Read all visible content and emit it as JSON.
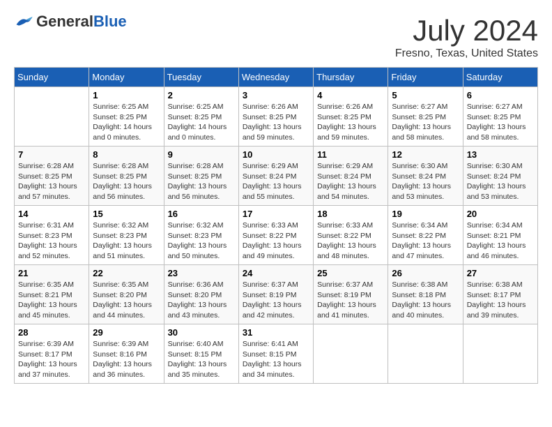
{
  "header": {
    "logo_general": "General",
    "logo_blue": "Blue",
    "title": "July 2024",
    "location": "Fresno, Texas, United States"
  },
  "weekdays": [
    "Sunday",
    "Monday",
    "Tuesday",
    "Wednesday",
    "Thursday",
    "Friday",
    "Saturday"
  ],
  "weeks": [
    [
      {
        "day": "",
        "info": ""
      },
      {
        "day": "1",
        "info": "Sunrise: 6:25 AM\nSunset: 8:25 PM\nDaylight: 14 hours\nand 0 minutes."
      },
      {
        "day": "2",
        "info": "Sunrise: 6:25 AM\nSunset: 8:25 PM\nDaylight: 14 hours\nand 0 minutes."
      },
      {
        "day": "3",
        "info": "Sunrise: 6:26 AM\nSunset: 8:25 PM\nDaylight: 13 hours\nand 59 minutes."
      },
      {
        "day": "4",
        "info": "Sunrise: 6:26 AM\nSunset: 8:25 PM\nDaylight: 13 hours\nand 59 minutes."
      },
      {
        "day": "5",
        "info": "Sunrise: 6:27 AM\nSunset: 8:25 PM\nDaylight: 13 hours\nand 58 minutes."
      },
      {
        "day": "6",
        "info": "Sunrise: 6:27 AM\nSunset: 8:25 PM\nDaylight: 13 hours\nand 58 minutes."
      }
    ],
    [
      {
        "day": "7",
        "info": "Sunrise: 6:28 AM\nSunset: 8:25 PM\nDaylight: 13 hours\nand 57 minutes."
      },
      {
        "day": "8",
        "info": "Sunrise: 6:28 AM\nSunset: 8:25 PM\nDaylight: 13 hours\nand 56 minutes."
      },
      {
        "day": "9",
        "info": "Sunrise: 6:28 AM\nSunset: 8:25 PM\nDaylight: 13 hours\nand 56 minutes."
      },
      {
        "day": "10",
        "info": "Sunrise: 6:29 AM\nSunset: 8:24 PM\nDaylight: 13 hours\nand 55 minutes."
      },
      {
        "day": "11",
        "info": "Sunrise: 6:29 AM\nSunset: 8:24 PM\nDaylight: 13 hours\nand 54 minutes."
      },
      {
        "day": "12",
        "info": "Sunrise: 6:30 AM\nSunset: 8:24 PM\nDaylight: 13 hours\nand 53 minutes."
      },
      {
        "day": "13",
        "info": "Sunrise: 6:30 AM\nSunset: 8:24 PM\nDaylight: 13 hours\nand 53 minutes."
      }
    ],
    [
      {
        "day": "14",
        "info": "Sunrise: 6:31 AM\nSunset: 8:23 PM\nDaylight: 13 hours\nand 52 minutes."
      },
      {
        "day": "15",
        "info": "Sunrise: 6:32 AM\nSunset: 8:23 PM\nDaylight: 13 hours\nand 51 minutes."
      },
      {
        "day": "16",
        "info": "Sunrise: 6:32 AM\nSunset: 8:23 PM\nDaylight: 13 hours\nand 50 minutes."
      },
      {
        "day": "17",
        "info": "Sunrise: 6:33 AM\nSunset: 8:22 PM\nDaylight: 13 hours\nand 49 minutes."
      },
      {
        "day": "18",
        "info": "Sunrise: 6:33 AM\nSunset: 8:22 PM\nDaylight: 13 hours\nand 48 minutes."
      },
      {
        "day": "19",
        "info": "Sunrise: 6:34 AM\nSunset: 8:22 PM\nDaylight: 13 hours\nand 47 minutes."
      },
      {
        "day": "20",
        "info": "Sunrise: 6:34 AM\nSunset: 8:21 PM\nDaylight: 13 hours\nand 46 minutes."
      }
    ],
    [
      {
        "day": "21",
        "info": "Sunrise: 6:35 AM\nSunset: 8:21 PM\nDaylight: 13 hours\nand 45 minutes."
      },
      {
        "day": "22",
        "info": "Sunrise: 6:35 AM\nSunset: 8:20 PM\nDaylight: 13 hours\nand 44 minutes."
      },
      {
        "day": "23",
        "info": "Sunrise: 6:36 AM\nSunset: 8:20 PM\nDaylight: 13 hours\nand 43 minutes."
      },
      {
        "day": "24",
        "info": "Sunrise: 6:37 AM\nSunset: 8:19 PM\nDaylight: 13 hours\nand 42 minutes."
      },
      {
        "day": "25",
        "info": "Sunrise: 6:37 AM\nSunset: 8:19 PM\nDaylight: 13 hours\nand 41 minutes."
      },
      {
        "day": "26",
        "info": "Sunrise: 6:38 AM\nSunset: 8:18 PM\nDaylight: 13 hours\nand 40 minutes."
      },
      {
        "day": "27",
        "info": "Sunrise: 6:38 AM\nSunset: 8:17 PM\nDaylight: 13 hours\nand 39 minutes."
      }
    ],
    [
      {
        "day": "28",
        "info": "Sunrise: 6:39 AM\nSunset: 8:17 PM\nDaylight: 13 hours\nand 37 minutes."
      },
      {
        "day": "29",
        "info": "Sunrise: 6:39 AM\nSunset: 8:16 PM\nDaylight: 13 hours\nand 36 minutes."
      },
      {
        "day": "30",
        "info": "Sunrise: 6:40 AM\nSunset: 8:15 PM\nDaylight: 13 hours\nand 35 minutes."
      },
      {
        "day": "31",
        "info": "Sunrise: 6:41 AM\nSunset: 8:15 PM\nDaylight: 13 hours\nand 34 minutes."
      },
      {
        "day": "",
        "info": ""
      },
      {
        "day": "",
        "info": ""
      },
      {
        "day": "",
        "info": ""
      }
    ]
  ]
}
